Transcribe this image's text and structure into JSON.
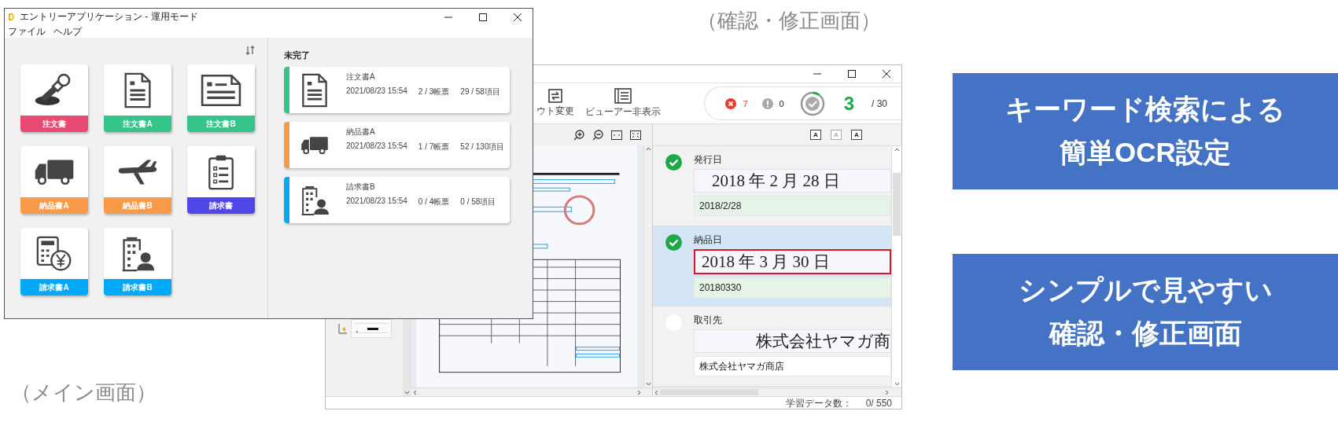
{
  "captions": [
    {
      "text": "（確認・修正画面）"
    },
    {
      "text": "（メイン画面）"
    }
  ],
  "review_window": {
    "toolbar": [
      "ウト変更",
      "ビューアー非表示"
    ],
    "status": {
      "errors": "7",
      "warnings": "0",
      "done": "3",
      "total": "/ 30"
    },
    "font_size_buttons": [
      {
        "label": "A",
        "disabled": false
      },
      {
        "label": "A",
        "disabled": true
      },
      {
        "label": "A",
        "disabled": false
      }
    ],
    "fields": [
      {
        "label": "発行日",
        "image_text": "2018 年  2 月 28 日",
        "value": "2018/2/28",
        "checked": true,
        "selected": false
      },
      {
        "label": "納品日",
        "image_text": "2018 年  3 月 30 日",
        "value": "20180330",
        "checked": true,
        "selected": true
      },
      {
        "label": "取引先",
        "image_text": "株式会社ヤマガ商",
        "value": "株式会社ヤマガ商店",
        "checked": false,
        "selected": false
      }
    ],
    "learning_label": "学習データ数：",
    "learning_count": "0/ 550"
  },
  "main_window": {
    "title": "エントリーアプリケーション - 運用モード",
    "menu": [
      "ファイル",
      "ヘルプ"
    ],
    "tiles": [
      {
        "label": "注文書",
        "color": "#e94a73"
      },
      {
        "label": "注文書A",
        "color": "#35c48a"
      },
      {
        "label": "注文書B",
        "color": "#35c48a"
      },
      {
        "label": "納品書A",
        "color": "#f99a48"
      },
      {
        "label": "納品書B",
        "color": "#f99a48"
      },
      {
        "label": "請求書",
        "color": "#5046e5"
      },
      {
        "label": "請求書A",
        "color": "#00aaf8"
      },
      {
        "label": "請求書B",
        "color": "#00aaf8"
      }
    ],
    "pending": {
      "heading": "未完了",
      "cards": [
        {
          "title": "注文書A",
          "datetime": "2021/08/23 15:54",
          "forms": "2 / 3帳票",
          "items": "29 / 58項目",
          "color": "#35c48a"
        },
        {
          "title": "納品書A",
          "datetime": "2021/08/23 15:54",
          "forms": "1 / 7帳票",
          "items": "52 / 130項目",
          "color": "#f99a48"
        },
        {
          "title": "請求書B",
          "datetime": "2021/08/23 15:54",
          "forms": "0 / 4帳票",
          "items": "0 / 58項目",
          "color": "#00aaf8"
        }
      ]
    }
  },
  "callouts": [
    {
      "lines": [
        "キーワード検索による",
        "簡単OCR設定"
      ]
    },
    {
      "lines": [
        "シンプルで見やすい",
        "確認・修正画面"
      ]
    }
  ]
}
